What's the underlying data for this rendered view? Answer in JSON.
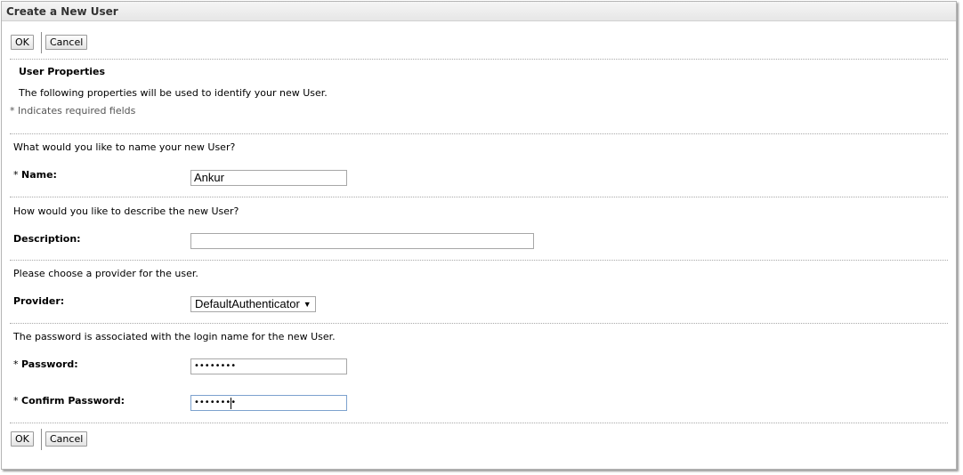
{
  "window": {
    "title": "Create a New User"
  },
  "toolbar_top": {
    "ok_label": "OK",
    "cancel_label": "Cancel"
  },
  "section": {
    "heading": "User Properties",
    "intro": "The following properties will be used to identify your new User.",
    "required_note": "* Indicates required fields"
  },
  "name_group": {
    "question": "What would you like to name your new User?",
    "required_mark": "* ",
    "label": "Name:",
    "value": "Ankur"
  },
  "description_group": {
    "question": "How would you like to describe the new User?",
    "label": "Description:",
    "value": ""
  },
  "provider_group": {
    "question": "Please choose a provider for the user.",
    "label": "Provider:",
    "selected": "DefaultAuthenticator",
    "arrow": "▼"
  },
  "password_group": {
    "question": "The password is associated with the login name for the new User.",
    "required_mark": "* ",
    "password_label": "Password:",
    "password_mask": "••••••••",
    "confirm_required_mark": "* ",
    "confirm_label": "Confirm Password:",
    "confirm_mask": "••••••••"
  },
  "toolbar_bottom": {
    "ok_label": "OK",
    "cancel_label": "Cancel"
  },
  "colors": {
    "border": "#b5b5b5",
    "focus_border": "#7da2ce",
    "titlebar": "#ececec"
  }
}
